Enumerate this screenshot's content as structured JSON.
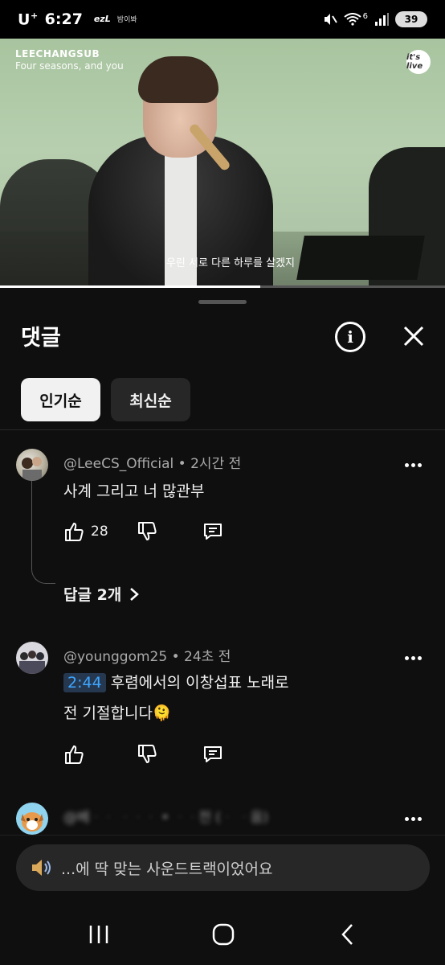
{
  "status_bar": {
    "carrier": "U",
    "carrier_sup": "+",
    "time": "6:27",
    "app1": "ezL",
    "app2": "밤이봐",
    "network": "6",
    "battery": "39"
  },
  "video": {
    "artist": "LEECHANGSUB",
    "song": "Four seasons, and you",
    "logo": "it's live",
    "subtitle": "우린 서로 다른 하루를 살겠지",
    "progress_fraction": 0.585
  },
  "panel": {
    "title": "댓글",
    "info_icon": "info-icon",
    "close_icon": "close-icon",
    "info_glyph": "i",
    "chips": [
      {
        "label": "인기순",
        "active": true
      },
      {
        "label": "최신순",
        "active": false
      }
    ]
  },
  "comments": [
    {
      "author": "@LeeCS_Official",
      "time": " • 2시간 전",
      "text": "사계 그리고 너 많관부",
      "likes": "28",
      "replies_label": "답글 2개"
    },
    {
      "author": "@younggom25",
      "time": " • 24초 전",
      "timestamp_link": "2:44",
      "text_line1": " 후렴에서의 이창섭표 노래로",
      "text_line2": "전 기절합니다🫠"
    },
    {
      "author_blurred": "@베ᆞ​ᆞ ᆞᆞᆞ • ᆞᆞ전 (ᆞ ᆞ음)",
      "text_blurred": "ᆞᆞᆞ ᆞᆞ ᆞᆞᆞ"
    }
  ],
  "composer": {
    "placeholder": "...에 딱 맞는 사운드트랙이었어요",
    "icon": "speaker-icon"
  },
  "nav": {
    "recents_icon": "recents-icon",
    "home_icon": "home-icon",
    "back_icon": "back-icon"
  },
  "colors": {
    "background": "#0f0f0f",
    "chip_active": "#f1f1f1",
    "chip_inactive": "#272727",
    "link_blue": "#3ea6ff",
    "secondary_text": "#aaaaaa"
  }
}
